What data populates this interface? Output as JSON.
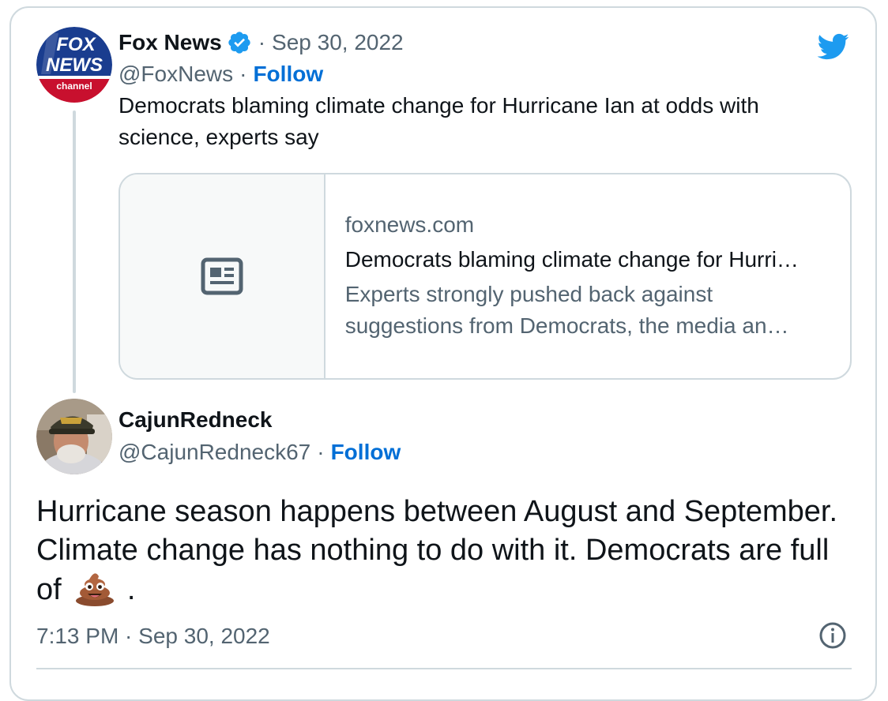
{
  "quoted_tweet": {
    "author_name": "Fox News",
    "date": "Sep 30, 2022",
    "handle": "@FoxNews",
    "follow_label": "Follow",
    "text": "Democrats blaming climate change for Hurricane Ian at odds with science, experts say",
    "avatar_text": {
      "line1": "FOX",
      "line2": "NEWS",
      "line3": "channel"
    },
    "link_card": {
      "domain": "foxnews.com",
      "title": "Democrats blaming climate change for Hurri…",
      "description_line1": "Experts strongly pushed back against",
      "description_line2": "suggestions from Democrats, the media an…",
      "thumb_icon": "news-article-icon"
    }
  },
  "reply_tweet": {
    "author_name": "CajunRedneck",
    "handle": "@CajunRedneck67",
    "follow_label": "Follow",
    "text_part1": "Hurricane season happens between August and September. Climate change has nothing to do with it. Democrats are full of",
    "text_part2": ".",
    "emoji": "pile-of-poo-emoji",
    "timestamp": "7:13 PM · Sep 30, 2022"
  },
  "icons": {
    "verified": "verified-badge-icon",
    "logo": "twitter-bird-icon",
    "info": "info-icon"
  },
  "colors": {
    "link_blue": "#006fd6",
    "verified_blue": "#1d9bf0",
    "muted": "#536471",
    "border": "#cfd9de",
    "text": "#0f1419"
  }
}
